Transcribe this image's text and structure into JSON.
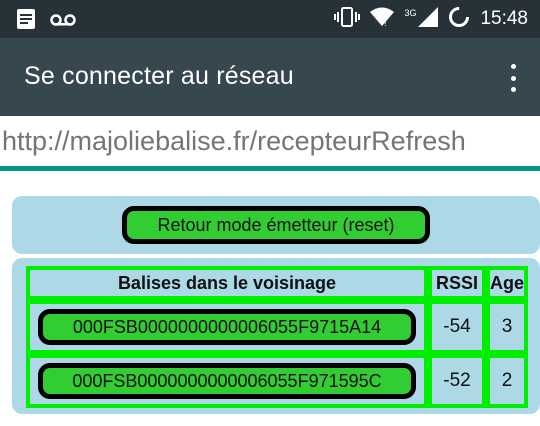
{
  "status_bar": {
    "time": "15:48",
    "network_type": "3G",
    "icons": [
      "notes-icon",
      "voicemail-icon",
      "vibrate-icon",
      "wifi-icon",
      "cell-signal-icon",
      "battery-loading-icon"
    ]
  },
  "app_bar": {
    "title": "Se connecter au réseau",
    "menu_icon": "more-vert-icon"
  },
  "url_bar": {
    "url": "http://majoliebalise.fr/recepteurRefresh"
  },
  "page": {
    "reset_button_label": "Retour mode émetteur (reset)",
    "table": {
      "headers": [
        "Balises dans le voisinage",
        "RSSI",
        "Age"
      ],
      "rows": [
        {
          "id": "000FSB0000000000006055F9715A14",
          "rssi": "-54",
          "age": "3"
        },
        {
          "id": "000FSB0000000000006055F971595C",
          "rssi": "-52",
          "age": "2"
        }
      ]
    }
  },
  "colors": {
    "status_bar": "#263238",
    "app_bar": "#37474f",
    "accent_line": "#009688",
    "panel": "#add8e6",
    "button_green": "#32cd32",
    "table_border": "#00ee00"
  }
}
